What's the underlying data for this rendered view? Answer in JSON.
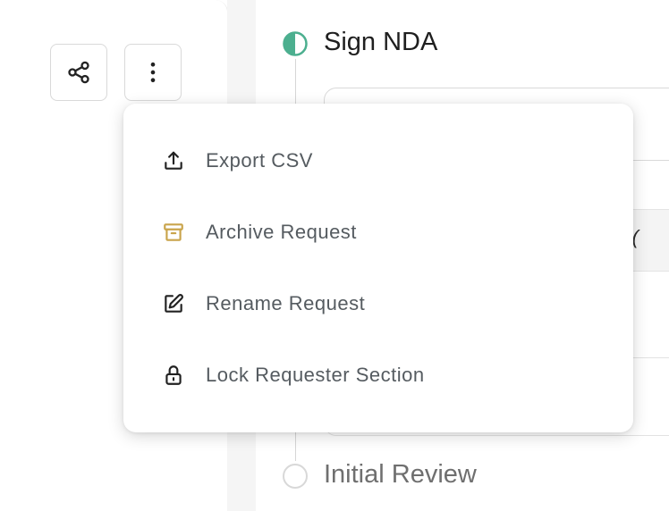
{
  "toolbar": {
    "share_icon": "share-icon",
    "more_icon": "more-vertical-icon"
  },
  "workflow": {
    "steps": [
      {
        "title": "Sign NDA",
        "status": "in-progress",
        "status_color": "#4caf8f"
      },
      {
        "title": "Initial Review",
        "status": "pending",
        "status_color": "#d8d8d8"
      }
    ],
    "table_header_fragment": "gn ("
  },
  "menu": {
    "items": [
      {
        "label": "Export CSV",
        "icon": "export-icon",
        "icon_color": "#222222"
      },
      {
        "label": "Archive Request",
        "icon": "archive-icon",
        "icon_color": "#c9a44b"
      },
      {
        "label": "Rename Request",
        "icon": "edit-icon",
        "icon_color": "#222222"
      },
      {
        "label": "Lock Requester Section",
        "icon": "lock-icon",
        "icon_color": "#222222"
      }
    ]
  }
}
